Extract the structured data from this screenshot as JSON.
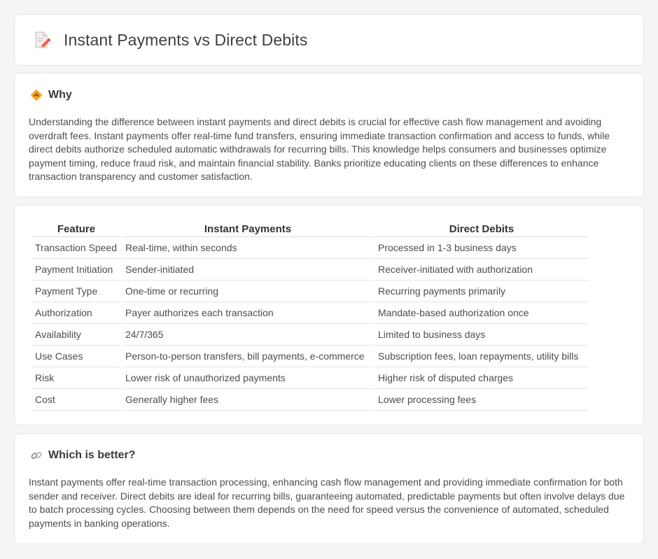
{
  "header": {
    "title": "Instant Payments vs Direct Debits",
    "icon": "document-pencil-icon"
  },
  "why": {
    "heading": "Why",
    "icon": "warning-diamond-icon",
    "text": "Understanding the difference between instant payments and direct debits is crucial for effective cash flow management and avoiding overdraft fees. Instant payments offer real-time fund transfers, ensuring immediate transaction confirmation and access to funds, while direct debits authorize scheduled automatic withdrawals for recurring bills. This knowledge helps consumers and businesses optimize payment timing, reduce fraud risk, and maintain financial stability. Banks prioritize educating clients on these differences to enhance transaction transparency and customer satisfaction."
  },
  "table": {
    "headers": [
      "Feature",
      "Instant Payments",
      "Direct Debits"
    ],
    "rows": [
      [
        "Transaction Speed",
        "Real-time, within seconds",
        "Processed in 1-3 business days"
      ],
      [
        "Payment Initiation",
        "Sender-initiated",
        "Receiver-initiated with authorization"
      ],
      [
        "Payment Type",
        "One-time or recurring",
        "Recurring payments primarily"
      ],
      [
        "Authorization",
        "Payer authorizes each transaction",
        "Mandate-based authorization once"
      ],
      [
        "Availability",
        "24/7/365",
        "Limited to business days"
      ],
      [
        "Use Cases",
        "Person-to-person transfers, bill payments, e-commerce",
        "Subscription fees, loan repayments, utility bills"
      ],
      [
        "Risk",
        "Lower risk of unauthorized payments",
        "Higher risk of disputed charges"
      ],
      [
        "Cost",
        "Generally higher fees",
        "Lower processing fees"
      ]
    ]
  },
  "better": {
    "heading": "Which is better?",
    "icon": "link-icon",
    "text": "Instant payments offer real-time transaction processing, enhancing cash flow management and providing immediate confirmation for both sender and receiver. Direct debits are ideal for recurring bills, guaranteeing automated, predictable payments but often involve delays due to batch processing cycles. Choosing between them depends on the need for speed versus the convenience of automated, scheduled payments in banking operations."
  },
  "colors": {
    "accent_orange": "#f5a623",
    "pencil": "#e8674a",
    "background": "#f4f5f7"
  }
}
